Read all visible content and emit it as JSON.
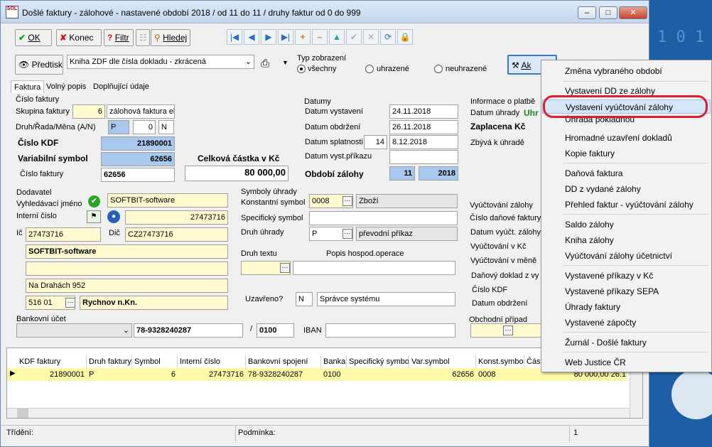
{
  "window": {
    "title": "Došlé faktury - zálohové - nastavené období 2018 / od 11 do 11 / druhy faktur od 0 do 999",
    "app_icon": "SOL"
  },
  "toolbar": {
    "ok": "OK",
    "konec": "Konec",
    "filtr": "Filtr",
    "hledej": "Hledej"
  },
  "subtoolbar": {
    "predtisk": "Předtisk",
    "report_select": "Kniha ZDF dle čísla dokladu - zkrácená",
    "typ_label": "Typ zobrazení",
    "opt_vsechny": "všechny",
    "opt_uhrazene": "uhrazené",
    "opt_neuhrazene": "neuhrazené",
    "akce": "Ak"
  },
  "tabs": [
    "Faktura",
    "Volný popis",
    "Doplňující údaje"
  ],
  "cislo_faktury": {
    "group": "Číslo faktury",
    "skupina_label": "Skupina faktury",
    "skupina_value": "6",
    "skupina_name": "zálohová faktura el",
    "druh_label": "Druh/Řada/Měna (A/N)",
    "druh_value": "P",
    "rada_value": "0",
    "mena_value": "N",
    "kdf_label": "Číslo KDF",
    "kdf_value": "21890001",
    "vs_label": "Variabilní symbol",
    "vs_value": "62656",
    "cf_label": "Číslo faktury",
    "cf_value": "62656"
  },
  "castka": {
    "label": "Celková částka v Kč",
    "value": "80 000,00"
  },
  "datumy": {
    "group": "Datumy",
    "vystaveni_label": "Datum vystavení",
    "vystaveni": "24.11.2018",
    "obdrzeni_label": "Datum obdržení",
    "obdrzeni": "26.11.2018",
    "splatnosti_label": "Datum splatnosti",
    "splatnost_days": "14",
    "splatnost": "8.12.2018",
    "prikaz_label": "Datum vyst.příkazu",
    "obdobi_label": "Období zálohy",
    "obdobi_month": "11",
    "obdobi_year": "2018"
  },
  "platba": {
    "group": "Informace o platbě",
    "datum_uhrady_label": "Datum úhrady",
    "datum_uhrady_value": "Uhr",
    "zaplacena": "Zaplacena Kč",
    "zbyva": "Zbývá k úhradě"
  },
  "dodavatel": {
    "group": "Dodavatel",
    "vyhl_label": "Vyhledávací jméno",
    "vyhl_value": "SOFTBIT-software",
    "interni_label": "Interní číslo",
    "interni_value": "27473716",
    "ic_label": "Ič",
    "ic_value": "27473716",
    "dic_label": "Dič",
    "dic_value": "CZ27473716",
    "name": "SOFTBIT-software",
    "line2": "",
    "street": "Na Drahách 952",
    "psc": "516 01",
    "city": "Rychnov n.Kn."
  },
  "symboly": {
    "group": "Symboly úhrady",
    "konst_label": "Konstantní symbol",
    "konst_value": "0008",
    "konst_name": "Zboží",
    "spec_label": "Specifický symbol",
    "druh_label": "Druh úhrady",
    "druh_value": "P",
    "druh_name": "převodní příkaz"
  },
  "texty": {
    "druh_textu_label": "Druh textu",
    "popis_label": "Popis hospod.operace"
  },
  "uzavreno": {
    "label": "Uzavřeno?",
    "value": "N",
    "user": "Správce systému"
  },
  "bank": {
    "group": "Bankovní účet",
    "account": "78-9328240287",
    "code": "0100",
    "iban_label": "IBAN"
  },
  "vyuctovani": {
    "group": "Vyúčtování zálohy",
    "cislo_dan": "Číslo daňové faktury",
    "datum_vyuct": "Datum vyúčt. zálohy",
    "kc": "Vyúčtování v Kč",
    "mena": "Vyúčtování v měně"
  },
  "danovy": {
    "group": "Daňový doklad z vy",
    "kdf": "Číslo KDF",
    "datum": "Datum obdržení"
  },
  "obchodni": {
    "group": "Obchodní případ"
  },
  "grid": {
    "columns": [
      "KDF faktury",
      "Druh faktury",
      "Symbol",
      "Interní číslo",
      "Bankovní spojení",
      "Banka",
      "Specifický symbol",
      "Var.symbol",
      "Konst.symbol",
      "Část"
    ],
    "row": [
      "21890001",
      "P",
      "6",
      "27473716",
      "78-9328240287",
      "0100",
      "",
      "62656",
      "0008",
      "80 000,00 26.1"
    ]
  },
  "status": {
    "trideni": "Třídění:",
    "podminka": "Podmínka:",
    "count": "1"
  },
  "menu": {
    "items": [
      "Změna vybraného období",
      "Vystavení DD ze zálohy",
      "Vystavení vyúčtování zálohy",
      "Úhrada pokladnou",
      "Hromadné uzavření dokladů",
      "Kopie faktury",
      "Daňová faktura",
      "DD z vydané zálohy",
      "Přehled faktur - vyúčtování zálohy",
      "Saldo zálohy",
      "Kniha zálohy",
      "Vyúčtování zálohy účetnictví",
      "Vystavené příkazy v Kč",
      "Vystavené příkazy SEPA",
      "Úhrady faktury",
      "Vystavené zápočty",
      "Žurnál - Došlé faktury",
      "Web Justice ČR"
    ],
    "highlighted_index": 2
  },
  "colors": {
    "highlight_ring": "#e01d2e",
    "desktop": "#1d5fa6",
    "field_yellow": "#fffad0",
    "field_blue": "#a8c8ee"
  }
}
